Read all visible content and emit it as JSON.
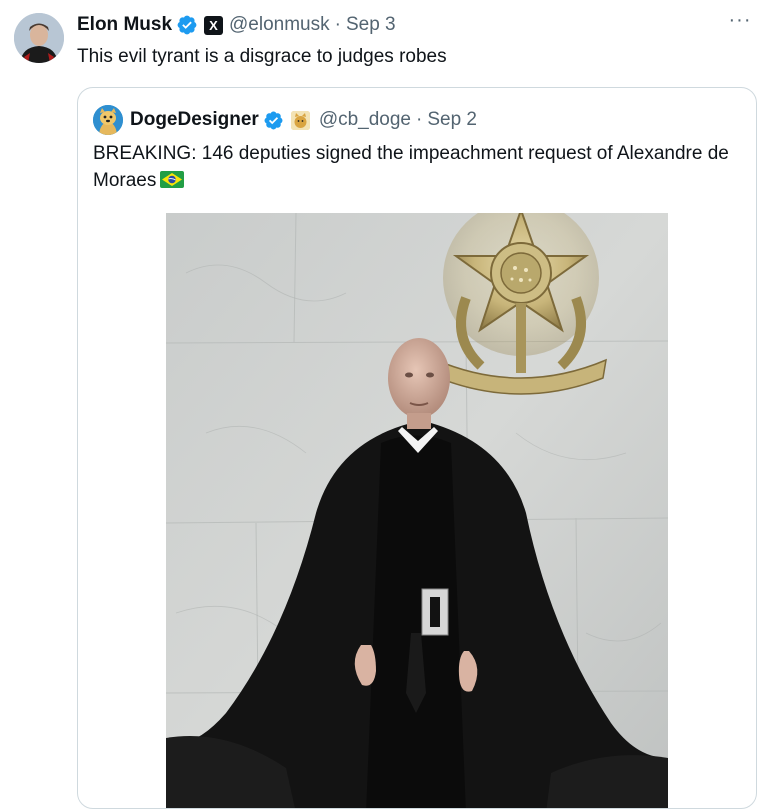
{
  "tweet": {
    "author_name": "Elon Musk",
    "author_handle": "@elonmusk",
    "separator": "·",
    "date": "Sep 3",
    "affiliation_label": "X",
    "text": "This evil tyrant is a disgrace to judges robes",
    "more_label": "···"
  },
  "quote": {
    "author_name": "DogeDesigner",
    "author_handle": "@cb_doge",
    "separator": "·",
    "date": "Sep 2",
    "text": "BREAKING: 146 deputies signed the impeachment request of Alexandre de Moraes",
    "flag_icon": "brazil-flag-icon"
  },
  "colors": {
    "verified_blue": "#1d9bf0",
    "secondary_text": "#536471",
    "border": "#cfd9de"
  }
}
